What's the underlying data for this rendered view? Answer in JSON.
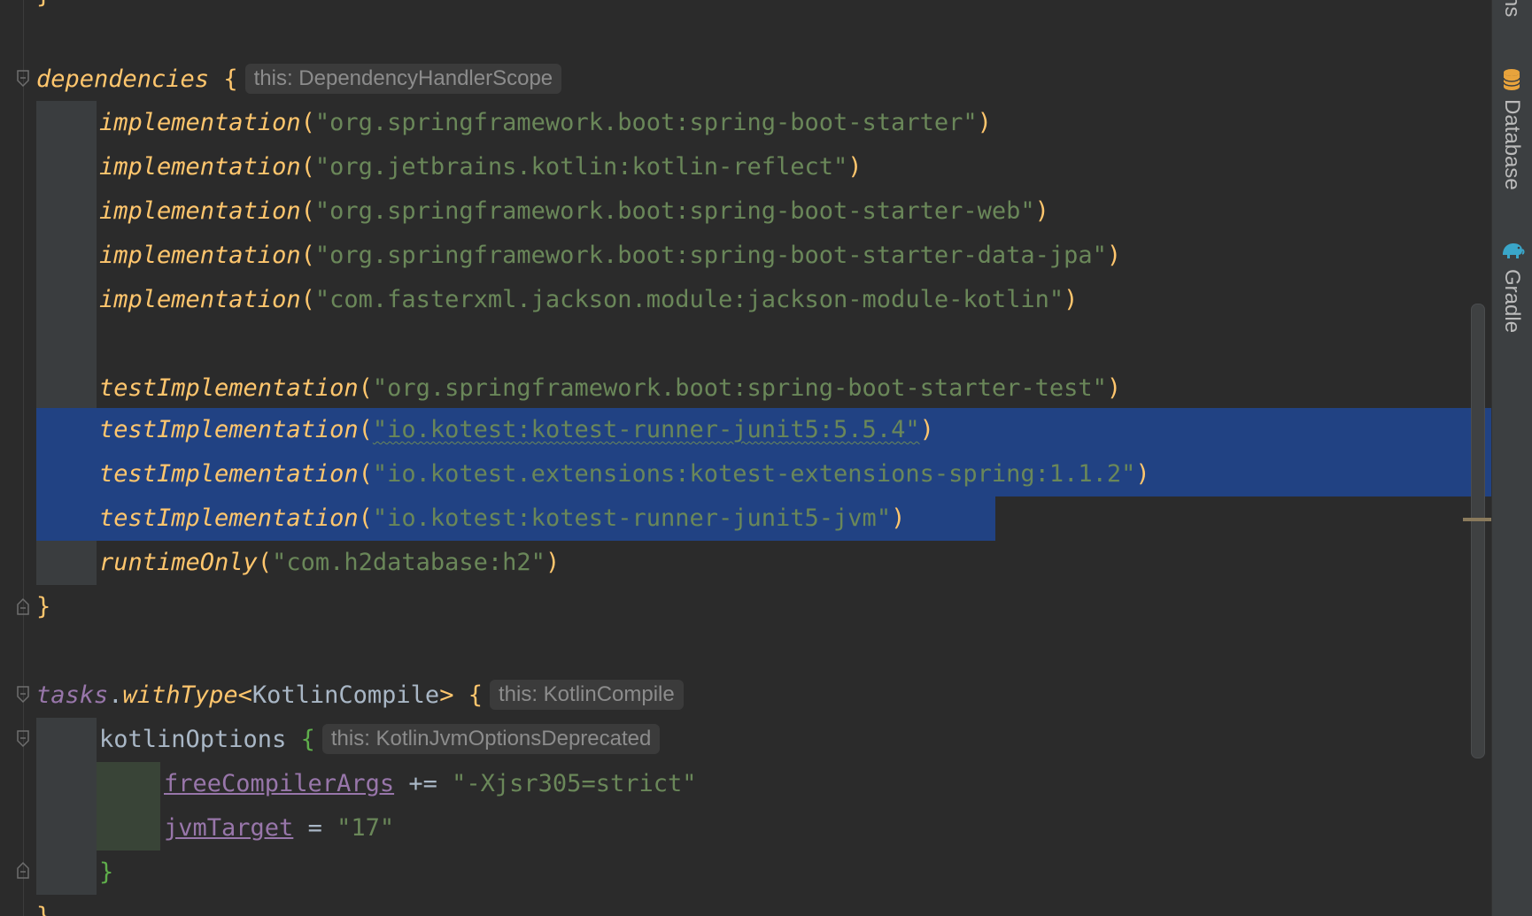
{
  "editor": {
    "lines": [
      {
        "kind": "deps_header",
        "name": "dependencies",
        "brace": "{",
        "hint": "this: DependencyHandlerScope"
      },
      {
        "kind": "call",
        "fn": "implementation",
        "arg": "\"org.springframework.boot:spring-boot-starter\""
      },
      {
        "kind": "call",
        "fn": "implementation",
        "arg": "\"org.jetbrains.kotlin:kotlin-reflect\""
      },
      {
        "kind": "call",
        "fn": "implementation",
        "arg": "\"org.springframework.boot:spring-boot-starter-web\""
      },
      {
        "kind": "call",
        "fn": "implementation",
        "arg": "\"org.springframework.boot:spring-boot-starter-data-jpa\""
      },
      {
        "kind": "call",
        "fn": "implementation",
        "arg": "\"com.fasterxml.jackson.module:jackson-module-kotlin\""
      },
      {
        "kind": "call",
        "fn": "testImplementation",
        "arg": "\"org.springframework.boot:spring-boot-starter-test\""
      },
      {
        "kind": "call",
        "fn": "testImplementation",
        "arg": "\"io.kotest:kotest-runner-junit5:5.5.4\""
      },
      {
        "kind": "call",
        "fn": "testImplementation",
        "arg": "\"io.kotest.extensions:kotest-extensions-spring:1.1.2\""
      },
      {
        "kind": "call",
        "fn": "testImplementation",
        "arg": "\"io.kotest:kotest-runner-junit5-jvm\""
      },
      {
        "kind": "call",
        "fn": "runtimeOnly",
        "arg": "\"com.h2database:h2\""
      },
      {
        "kind": "close",
        "text": "}"
      },
      {
        "kind": "tasks",
        "receiver": "tasks",
        "dot": ".",
        "fn": "withType",
        "lt": "<",
        "type": "KotlinCompile",
        "gt": ">",
        "brace": "{",
        "hint": "this: KotlinCompile"
      },
      {
        "kind": "block",
        "name": "kotlinOptions",
        "brace": "{",
        "hint": "this: KotlinJvmOptionsDeprecated"
      },
      {
        "kind": "assign",
        "prop": "freeCompilerArgs",
        "op": "+=",
        "value": "\"-Xjsr305=strict\""
      },
      {
        "kind": "assign",
        "prop": "jvmTarget",
        "op": "=",
        "value": "\"17\""
      },
      {
        "kind": "close",
        "text": "}"
      },
      {
        "kind": "close",
        "text": "}"
      }
    ],
    "paren_open": "(",
    "paren_close": ")"
  },
  "toolwindows": {
    "truncated_label": "ns",
    "database": {
      "label": "Database",
      "icon": "database-icon"
    },
    "gradle": {
      "label": "Gradle",
      "icon": "gradle-elephant-icon"
    }
  },
  "colors": {
    "background": "#2b2b2b",
    "selection": "#214283",
    "function": "#ffc66d",
    "string": "#6a8759",
    "property": "#9876aa",
    "gradle_icon": "#3aa6c9",
    "database_icon": "#e8a33c"
  }
}
